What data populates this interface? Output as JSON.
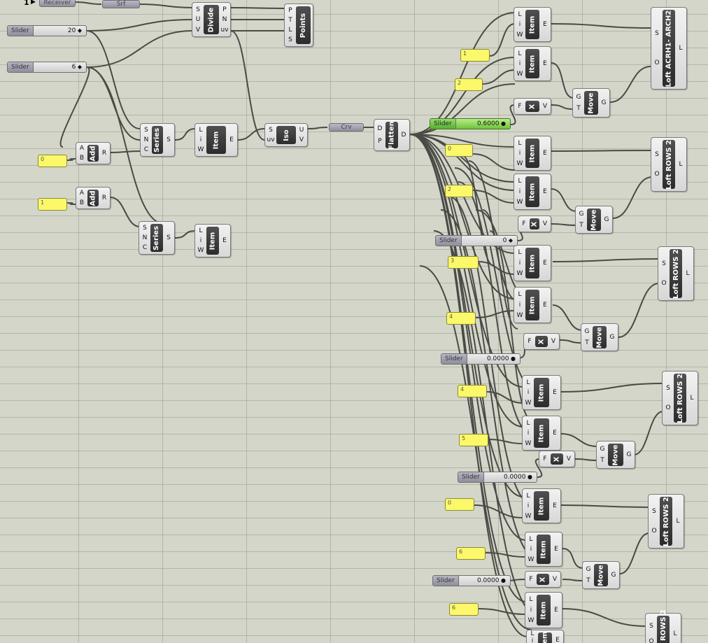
{
  "canvas": {
    "background": "#d4d6c9",
    "wire_color": "#4a4a46"
  },
  "receiver": {
    "count": "1",
    "label": "Receiver"
  },
  "params": {
    "srf": "Srf",
    "crv": "Crv"
  },
  "sliders": [
    {
      "label": "Slider",
      "value": "20",
      "knob": "diamond"
    },
    {
      "label": "Slider",
      "value": "6",
      "knob": "diamond"
    },
    {
      "label": "Slider",
      "value": "0.6000",
      "knob": "circle",
      "color": "#66bb35"
    },
    {
      "label": "Slider",
      "value": "0",
      "knob": "diamond"
    },
    {
      "label": "Slider",
      "value": "0.0000",
      "knob": "circle"
    },
    {
      "label": "Slider",
      "value": "0.0000",
      "knob": "circle"
    },
    {
      "label": "Slider",
      "value": "0.0000",
      "knob": "circle"
    }
  ],
  "panels": [
    "0",
    "1",
    "1",
    "2",
    "0",
    "2",
    "3",
    "4",
    "4",
    "5",
    "0",
    "6",
    "6"
  ],
  "components": {
    "divide": {
      "name": "Divide",
      "inputs": [
        "S",
        "U",
        "V"
      ],
      "outputs": [
        "P",
        "N",
        "uv"
      ]
    },
    "points": {
      "name": "Points",
      "inputs": [
        "P",
        "T",
        "L",
        "S"
      ],
      "outputs": []
    },
    "add": {
      "name": "Add",
      "inputs": [
        "A",
        "B"
      ],
      "outputs": [
        "R"
      ]
    },
    "series": {
      "name": "Series",
      "inputs": [
        "S",
        "N",
        "C"
      ],
      "outputs": [
        "S"
      ]
    },
    "item": {
      "name": "Item",
      "inputs": [
        "L",
        "i",
        "W"
      ],
      "outputs": [
        "E"
      ]
    },
    "iso": {
      "name": "Iso",
      "inputs": [
        "S",
        "uv"
      ],
      "outputs": [
        "U",
        "V"
      ]
    },
    "flatten": {
      "name": "Flatten",
      "inputs": [
        "D",
        "P"
      ],
      "outputs": [
        "D"
      ]
    },
    "move": {
      "name": "Move",
      "inputs": [
        "G",
        "T"
      ],
      "outputs": [
        "G"
      ]
    },
    "vecx": {
      "name": "X",
      "inputs": [
        "F"
      ],
      "outputs": [
        "V"
      ]
    },
    "loft_arch": {
      "name": "Loft ACRH1- ARCH2",
      "inputs": [
        "S",
        "O"
      ],
      "outputs": [
        "L"
      ]
    },
    "loft_rows": {
      "name": "Loft ROWS 2",
      "inputs": [
        "S",
        "O"
      ],
      "outputs": [
        "L"
      ]
    }
  }
}
